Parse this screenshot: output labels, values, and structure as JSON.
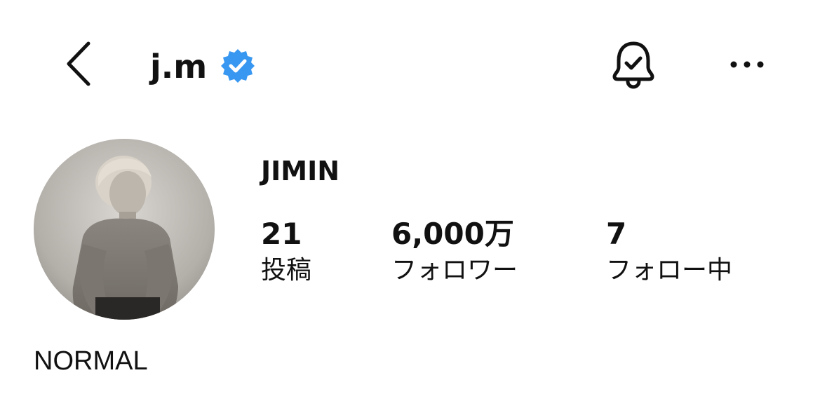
{
  "header": {
    "back_icon": "chevron-left-icon",
    "username": "j.m",
    "verified_icon": "verified-badge-icon",
    "bell_icon": "bell-check-icon",
    "more_icon": "more-horizontal-icon"
  },
  "profile": {
    "avatar_description_icon": "avatar",
    "display_name": "JIMIN",
    "stats": [
      {
        "value": "21",
        "label": "投稿"
      },
      {
        "value": "6,000万",
        "label": "フォロワー"
      },
      {
        "value": "7",
        "label": "フォロー中"
      }
    ],
    "bio": "NORMAL"
  },
  "colors": {
    "text": "#111111",
    "verified_blue": "#3897f0",
    "background": "#ffffff"
  }
}
